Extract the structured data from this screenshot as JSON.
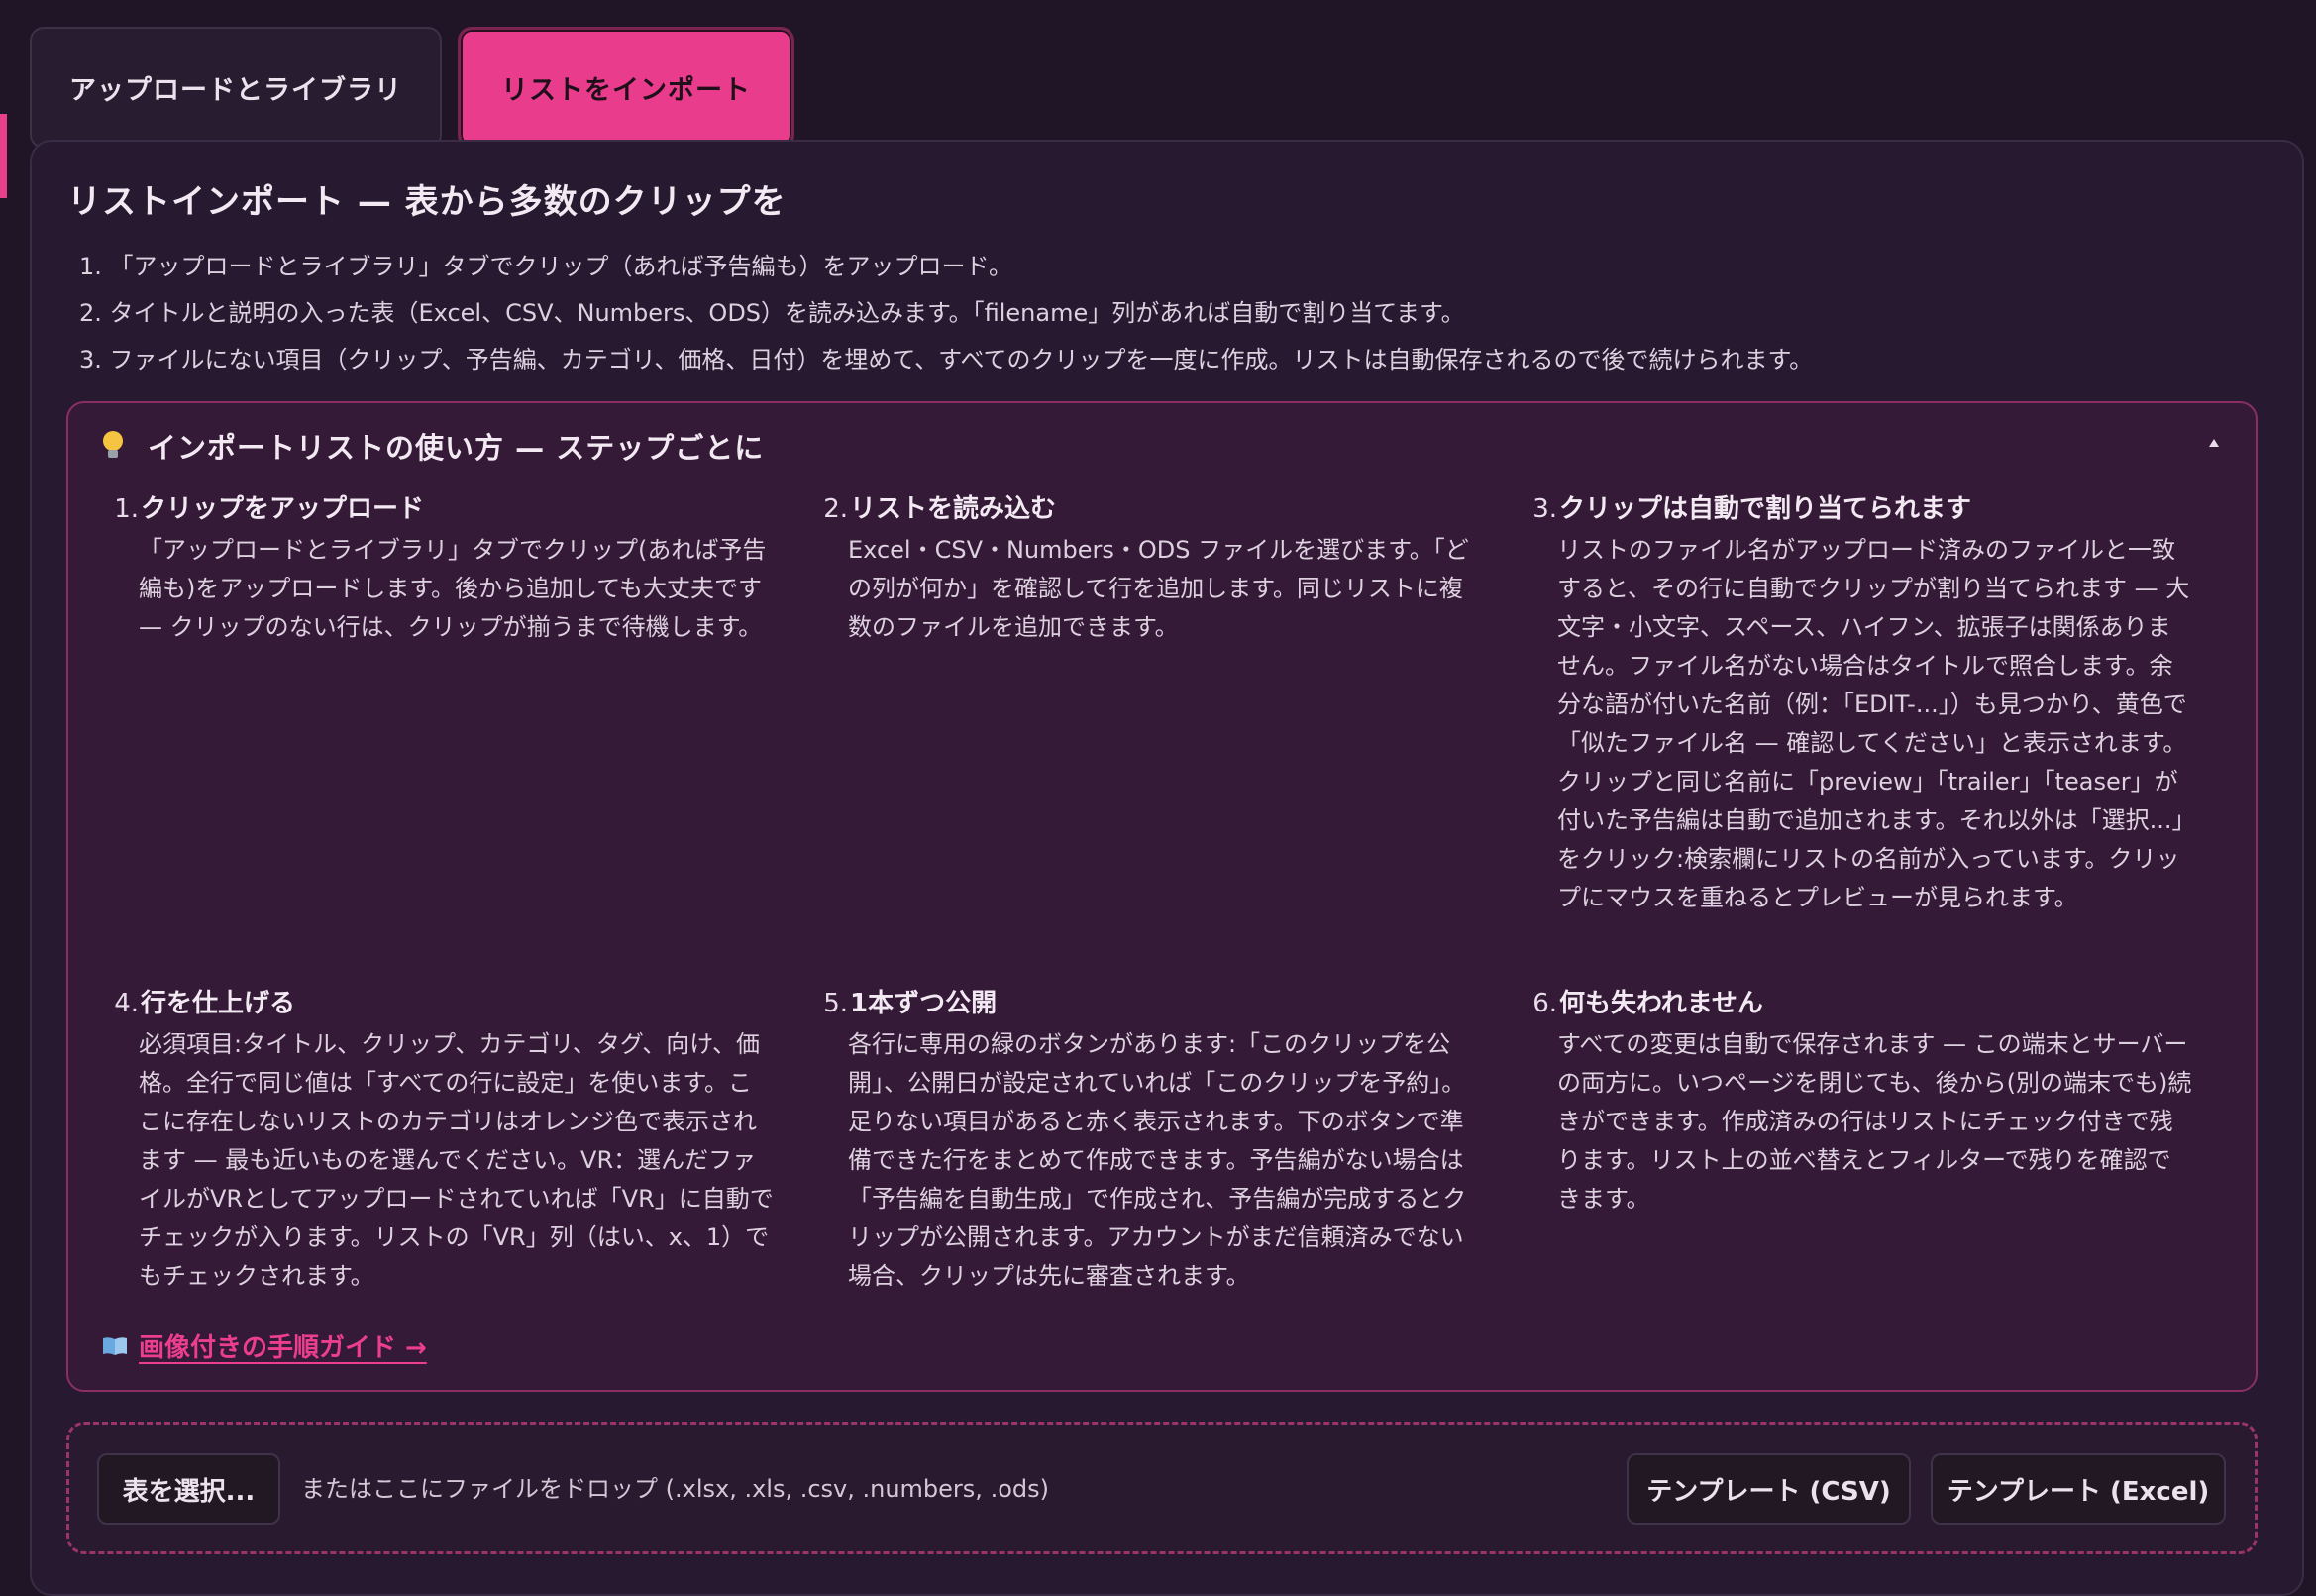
{
  "tabs": {
    "upload": "アップロードとライブラリ",
    "import": "リストをインポート"
  },
  "panel": {
    "title": "リストインポート — 表から多数のクリップを",
    "intro": [
      "1. 「アップロードとライブラリ」タブでクリップ（あれば予告編も）をアップロード。",
      "2. タイトルと説明の入った表（Excel、CSV、Numbers、ODS）を読み込みます。「filename」列があれば自動で割り当てます。",
      "3. ファイルにない項目（クリップ、予告編、カテゴリ、価格、日付）を埋めて、すべてのクリップを一度に作成。リストは自動保存されるので後で続けられます。"
    ]
  },
  "guide": {
    "title": "インポートリストの使い方 — ステップごとに",
    "steps": [
      {
        "num": "1.",
        "title": "クリップをアップロード",
        "body": "「アップロードとライブラリ」タブでクリップ(あれば予告編も)をアップロードします。後から追加しても大丈夫です — クリップのない行は、クリップが揃うまで待機します。"
      },
      {
        "num": "2.",
        "title": "リストを読み込む",
        "body": "Excel・CSV・Numbers・ODS ファイルを選びます。「どの列が何か」を確認して行を追加します。同じリストに複数のファイルを追加できます。"
      },
      {
        "num": "3.",
        "title": "クリップは自動で割り当てられます",
        "body": "リストのファイル名がアップロード済みのファイルと一致すると、その行に自動でクリップが割り当てられます — 大文字・小文字、スペース、ハイフン、拡張子は関係ありません。ファイル名がない場合はタイトルで照合します。余分な語が付いた名前（例：「EDIT-...」）も見つかり、黄色で「似たファイル名 — 確認してください」と表示されます。クリップと同じ名前に「preview」「trailer」「teaser」が付いた予告編は自動で追加されます。それ以外は「選択...」をクリック:検索欄にリストの名前が入っています。クリップにマウスを重ねるとプレビューが見られます。"
      },
      {
        "num": "4.",
        "title": "行を仕上げる",
        "body": "必須項目:タイトル、クリップ、カテゴリ、タグ、向け、価格。全行で同じ値は「すべての行に設定」を使います。ここに存在しないリストのカテゴリはオレンジ色で表示されます — 最も近いものを選んでください。VR：選んだファイルがVRとしてアップロードされていれば「VR」に自動でチェックが入ります。リストの「VR」列（はい、x、1）でもチェックされます。"
      },
      {
        "num": "5.",
        "title": "1本ずつ公開",
        "body": "各行に専用の緑のボタンがあります:「このクリップを公開」、公開日が設定されていれば「このクリップを予約」。足りない項目があると赤く表示されます。下のボタンで準備できた行をまとめて作成できます。予告編がない場合は「予告編を自動生成」で作成され、予告編が完成するとクリップが公開されます。アカウントがまだ信頼済みでない場合、クリップは先に審査されます。"
      },
      {
        "num": "6.",
        "title": "何も失われません",
        "body": "すべての変更は自動で保存されます — この端末とサーバーの両方に。いつページを閉じても、後から(別の端末でも)続きができます。作成済みの行はリストにチェック付きで残ります。リスト上の並べ替えとフィルターで残りを確認できます。"
      }
    ],
    "link": "画像付きの手順ガイド →"
  },
  "dropzone": {
    "pick_button": "表を選択...",
    "hint": "またはここにファイルをドロップ (.xlsx, .xls, .csv, .numbers, .ods)",
    "template_csv": "テンプレート (CSV)",
    "template_excel": "テンプレート (Excel)"
  },
  "colors": {
    "accent": "#ea3c8d",
    "background": "#1f1526",
    "guide_border": "#8a2f63"
  }
}
